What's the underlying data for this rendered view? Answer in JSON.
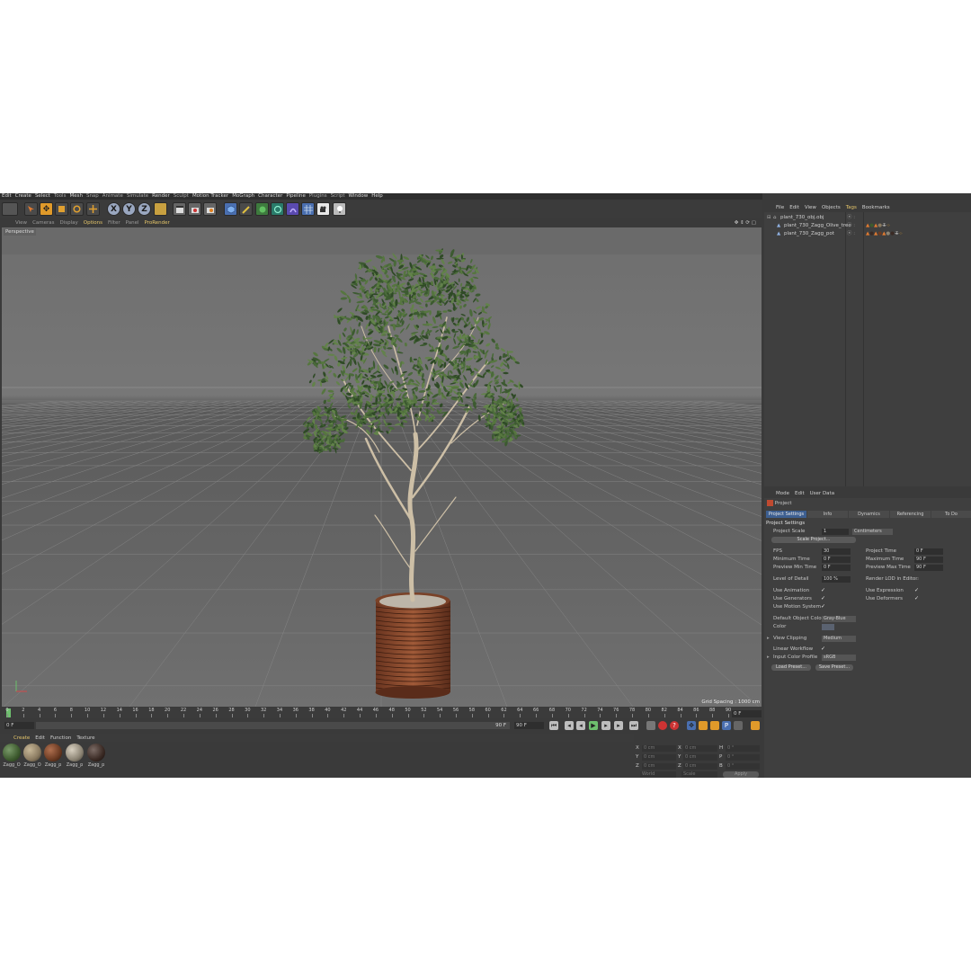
{
  "menubar": [
    "Edit",
    "Create",
    "Select",
    "Tools",
    "Mesh",
    "Snap",
    "Animate",
    "Simulate",
    "Render",
    "Sculpt",
    "Motion Tracker",
    "MoGraph",
    "Character",
    "Pipeline",
    "Plugins",
    "Script",
    "Window",
    "Help"
  ],
  "toolbar": {
    "axis_x": "X",
    "axis_y": "Y",
    "axis_z": "Z"
  },
  "viewport": {
    "menu": [
      "View",
      "Cameras",
      "Display",
      "Options",
      "Filter",
      "Panel",
      "ProRender"
    ],
    "camera_label": "Perspective",
    "grid_spacing": "Grid Spacing : 1000 cm"
  },
  "timeline": {
    "ticks": [
      "0",
      "2",
      "4",
      "6",
      "8",
      "10",
      "12",
      "14",
      "16",
      "18",
      "20",
      "22",
      "24",
      "26",
      "28",
      "30",
      "32",
      "34",
      "36",
      "38",
      "40",
      "42",
      "44",
      "46",
      "48",
      "50",
      "52",
      "54",
      "56",
      "58",
      "60",
      "62",
      "64",
      "66",
      "68",
      "70",
      "72",
      "74",
      "76",
      "78",
      "80",
      "82",
      "84",
      "86",
      "88",
      "90"
    ],
    "current_frame": "0 F",
    "start_field": "0 F",
    "end_slider_label": "90 F",
    "end_field": "90 F"
  },
  "materials": {
    "menu": [
      "Create",
      "Edit",
      "Function",
      "Texture"
    ],
    "items": [
      {
        "label": "Zagg_O",
        "color": "#3d5a2e"
      },
      {
        "label": "Zagg_O",
        "color": "#8a7a60"
      },
      {
        "label": "Zagg_p",
        "color": "#6a3a22"
      },
      {
        "label": "Zagg_p",
        "color": "#8c8474"
      },
      {
        "label": "Zagg_p",
        "color": "#3a2a24"
      }
    ]
  },
  "coordinates": {
    "rows": [
      {
        "a": "X",
        "av": "0 cm",
        "b": "X",
        "bv": "0 cm",
        "c": "H",
        "cv": "0 °"
      },
      {
        "a": "Y",
        "av": "0 cm",
        "b": "Y",
        "bv": "0 cm",
        "c": "P",
        "cv": "0 °"
      },
      {
        "a": "Z",
        "av": "0 cm",
        "b": "Z",
        "bv": "0 cm",
        "c": "B",
        "cv": "0 °"
      }
    ],
    "mode1": "World",
    "mode2": "Scale",
    "apply": "Apply"
  },
  "object_manager": {
    "menu": [
      "File",
      "Edit",
      "View",
      "Objects",
      "Tags",
      "Bookmarks"
    ],
    "objects": [
      {
        "name": "plant_730_obj.obj",
        "indent": 0
      },
      {
        "name": "plant_730_Zagg_Olive_tree",
        "indent": 1
      },
      {
        "name": "plant_730_Zagg_pot",
        "indent": 1
      }
    ]
  },
  "attributes": {
    "menu": [
      "Mode",
      "Edit",
      "User Data"
    ],
    "header": "Project",
    "tabs": [
      "Project Settings",
      "Info",
      "Dynamics",
      "Referencing",
      "To Do"
    ],
    "section": "Project Settings",
    "project_scale_label": "Project Scale",
    "project_scale_value": "1",
    "project_scale_unit": "Centimeters",
    "scale_project_btn": "Scale Project...",
    "fps_label": "FPS",
    "fps_value": "30",
    "project_time_label": "Project Time",
    "project_time_value": "0 F",
    "min_time_label": "Minimum Time",
    "min_time_value": "0 F",
    "max_time_label": "Maximum Time",
    "max_time_value": "90 F",
    "prev_min_label": "Preview Min Time",
    "prev_min_value": "0 F",
    "prev_max_label": "Preview Max Time",
    "prev_max_value": "90 F",
    "lod_label": "Level of Detail",
    "lod_value": "100 %",
    "render_lod_label": "Render LOD in Editor",
    "use_animation": "Use Animation",
    "use_expression": "Use Expression",
    "use_generators": "Use Generators",
    "use_deformers": "Use Deformers",
    "use_motion_system": "Use Motion System",
    "default_color_label": "Default Object Color",
    "default_color_value": "Gray-Blue",
    "color_label": "Color",
    "view_clipping_label": "View Clipping",
    "view_clipping_value": "Medium",
    "linear_workflow_label": "Linear Workflow",
    "input_color_label": "Input Color Profile",
    "input_color_value": "sRGB",
    "load_preset": "Load Preset...",
    "save_preset": "Save Preset..."
  }
}
